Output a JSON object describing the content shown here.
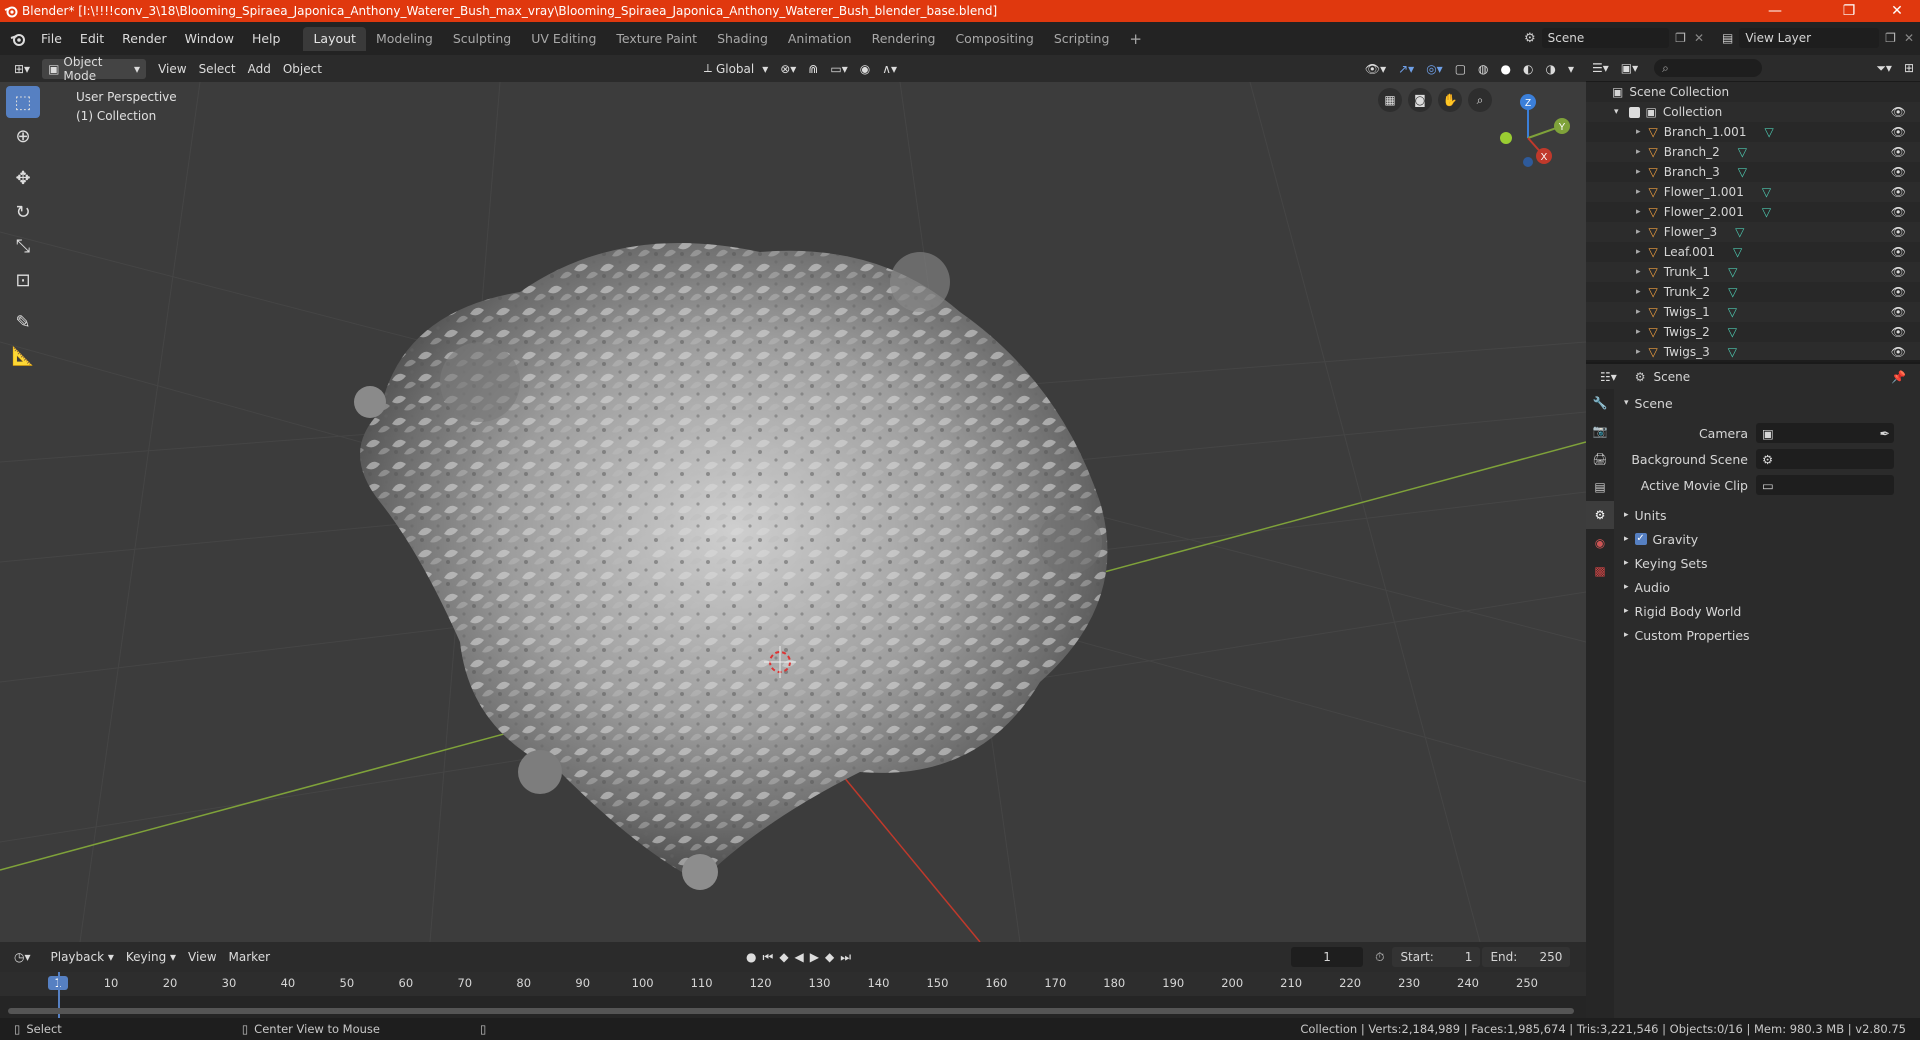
{
  "window": {
    "title": "Blender* [I:\\!!!!conv_3\\18\\Blooming_Spiraea_Japonica_Anthony_Waterer_Bush_max_vray\\Blooming_Spiraea_Japonica_Anthony_Waterer_Bush_blender_base.blend]",
    "minimize": "—",
    "maximize": "❐",
    "close": "✕"
  },
  "menu": {
    "items": [
      "File",
      "Edit",
      "Render",
      "Window",
      "Help"
    ],
    "workspaces": [
      "Layout",
      "Modeling",
      "Sculpting",
      "UV Editing",
      "Texture Paint",
      "Shading",
      "Animation",
      "Rendering",
      "Compositing",
      "Scripting"
    ],
    "add_workspace": "+",
    "scene_label": "Scene",
    "view_layer_label": "View Layer"
  },
  "viewport_header": {
    "mode": "Object Mode",
    "menus": [
      "View",
      "Select",
      "Add",
      "Object"
    ],
    "transform_orientation": "Global"
  },
  "viewport": {
    "perspective": "User Perspective",
    "collection": "(1) Collection",
    "gizmo": {
      "z": "Z",
      "y": "Y",
      "x": "X"
    }
  },
  "outliner": {
    "root": "Scene Collection",
    "collection": "Collection",
    "items": [
      "Branch_1.001",
      "Branch_2",
      "Branch_3",
      "Flower_1.001",
      "Flower_2.001",
      "Flower_3",
      "Leaf.001",
      "Trunk_1",
      "Trunk_2",
      "Twigs_1",
      "Twigs_2",
      "Twigs_3"
    ]
  },
  "properties": {
    "header": "Scene",
    "section": "Scene",
    "fields": [
      {
        "label": "Camera",
        "value": ""
      },
      {
        "label": "Background Scene",
        "value": ""
      },
      {
        "label": "Active Movie Clip",
        "value": ""
      }
    ],
    "panels": [
      "Units",
      "Gravity",
      "Keying Sets",
      "Audio",
      "Rigid Body World",
      "Custom Properties"
    ],
    "gravity_checked": true
  },
  "timeline": {
    "menus": [
      "Playback",
      "Keying",
      "View",
      "Marker"
    ],
    "current_frame": "1",
    "start_label": "Start:",
    "start": "1",
    "end_label": "End:",
    "end": "250",
    "ticks": [
      "1",
      "10",
      "20",
      "30",
      "40",
      "50",
      "60",
      "70",
      "80",
      "90",
      "100",
      "110",
      "120",
      "130",
      "140",
      "150",
      "160",
      "170",
      "180",
      "190",
      "200",
      "210",
      "220",
      "230",
      "240",
      "250"
    ]
  },
  "status": {
    "left": "Select",
    "middle": "Center View to Mouse",
    "right": "Collection | Verts:2,184,989 | Faces:1,985,674 | Tris:3,221,546 | Objects:0/16 | Mem: 980.3 MB | v2.80.75"
  },
  "colors": {
    "titlebar": "#e0380e",
    "accent": "#5680c2",
    "x_axis": "#c0392b",
    "y_axis": "#7fa23a",
    "z_axis": "#3b7fd9"
  }
}
